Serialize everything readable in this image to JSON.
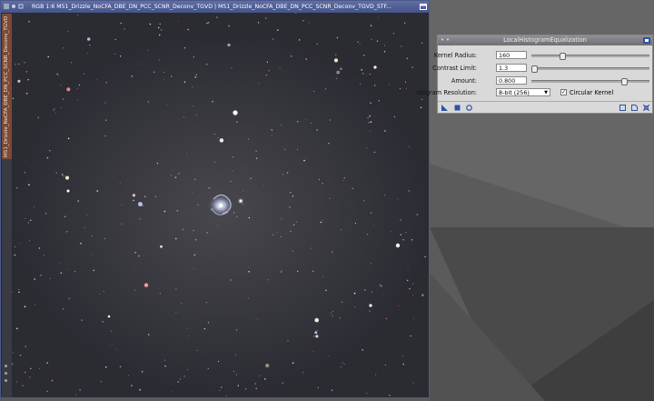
{
  "image_window": {
    "title": "RGB 1:6 M51_Drizzle_NoCFA_DBE_DN_PCC_SCNR_Deconv_TGVD | M51_Drizzle_NoCFA_DBE_DN_PCC_SCNR_Deconv_TGVD_STF...",
    "side_tab": "M51_Drizzle_NoCFA_DBE_DN_PCC_SCNR_Deconv_TGVD"
  },
  "panel": {
    "title": "LocalHistogramEqualization",
    "title_dots": "• •",
    "kernel_radius": {
      "label": "Kernel Radius:",
      "value": "160",
      "slider_fraction": 0.25
    },
    "contrast_limit": {
      "label": "Contrast Limit:",
      "value": "1.3",
      "slider_fraction": 0.0
    },
    "amount": {
      "label": "Amount:",
      "value": "0.800",
      "slider_fraction": 0.8
    },
    "histogram_resolution": {
      "label": "stogram Resolution:",
      "value": "8-bit (256)"
    },
    "circular_kernel": {
      "label": "Circular Kernel",
      "checked": true,
      "check_glyph": "✓"
    }
  },
  "colors": {
    "title_blue": "#4c5a8a",
    "panel_bg": "#d9d9d9",
    "icon_blue": "#2e52a5"
  },
  "icons": [
    "new-instance-icon",
    "apply-icon",
    "reset-icon",
    "preview-icon",
    "document-icon",
    "expand-icon",
    "help-icon"
  ]
}
